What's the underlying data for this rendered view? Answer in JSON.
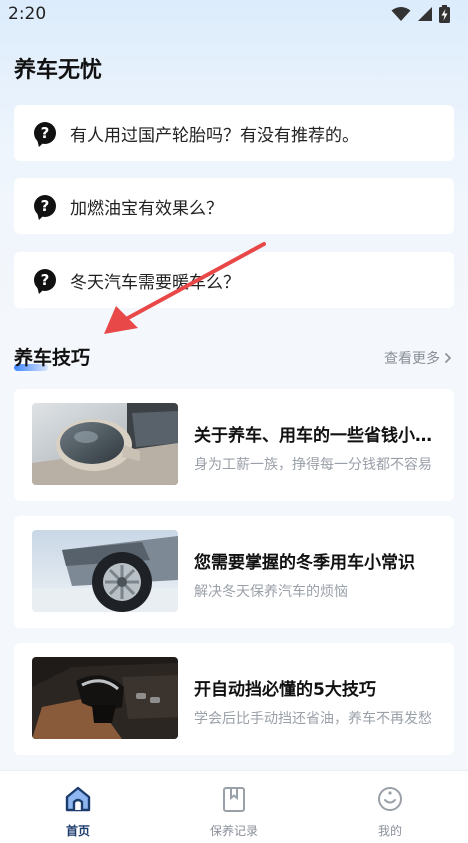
{
  "status_bar": {
    "time": "2:20"
  },
  "page": {
    "title": "养车无忧"
  },
  "questions": [
    {
      "text": "有人用过国产轮胎吗？有没有推荐的。",
      "icon": "question-icon"
    },
    {
      "text": "加燃油宝有效果么？",
      "icon": "question-icon"
    },
    {
      "text": "冬天汽车需要暖车么？",
      "icon": "question-icon"
    }
  ],
  "section": {
    "title": "养车技巧",
    "more_label": "查看更多"
  },
  "articles": [
    {
      "title": "关于养车、用车的一些省钱小技巧",
      "subtitle": "身为工薪一族，挣得每一分钱都不容易",
      "image": "car-mirror-photo"
    },
    {
      "title": "您需要掌握的冬季用车小常识",
      "subtitle": "解决冬天保养汽车的烦恼",
      "image": "car-tire-photo"
    },
    {
      "title": "开自动挡必懂的5大技巧",
      "subtitle": "学会后比手动挡还省油，养车不再发愁",
      "image": "gear-shifter-photo"
    }
  ],
  "tabbar": {
    "items": [
      {
        "label": "首页",
        "icon": "home-icon",
        "active": true
      },
      {
        "label": "保养记录",
        "icon": "record-icon",
        "active": false
      },
      {
        "label": "我的",
        "icon": "profile-icon",
        "active": false
      }
    ]
  },
  "colors": {
    "accent": "#3f86ff",
    "arrow": "#e84848",
    "tab_active": "#1d3c6e"
  }
}
